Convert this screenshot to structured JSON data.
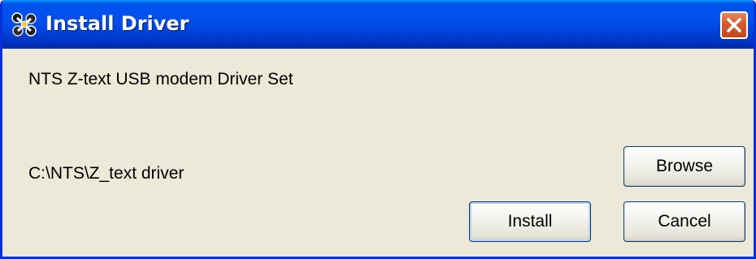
{
  "window": {
    "title": "Install Driver",
    "icon": "driver-install-icon",
    "close_icon": "close-icon"
  },
  "content": {
    "message": "NTS Z-text USB modem Driver Set",
    "path": "C:\\NTS\\Z_text driver"
  },
  "buttons": {
    "browse": "Browse",
    "install": "Install",
    "cancel": "Cancel"
  },
  "colors": {
    "titlebar": "#0050ee",
    "dialog_bg": "#ece9d8",
    "close_button": "#d55a2c"
  }
}
